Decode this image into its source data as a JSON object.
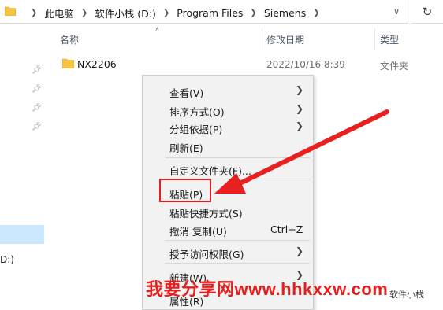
{
  "address_bar": {
    "crumbs": [
      "此电脑",
      "软件小栈 (D:)",
      "Program Files",
      "Siemens"
    ]
  },
  "columns": {
    "name": "名称",
    "modified": "修改日期",
    "type": "类型"
  },
  "files": [
    {
      "name": "NX2206",
      "modified": "2022/10/16 8:39",
      "type": "文件夹"
    }
  ],
  "left_pane": {
    "drive_label": "D:)"
  },
  "context_menu": {
    "view": "查看(V)",
    "sort": "排序方式(O)",
    "group": "分组依据(P)",
    "refresh": "刷新(E)",
    "customize": "自定义文件夹(F)...",
    "paste": "粘贴(P)",
    "paste_shortcut": "粘贴快捷方式(S)",
    "undo": "撤消 复制(U)",
    "undo_shortcut": "Ctrl+Z",
    "give_access": "授予访问权限(G)",
    "new": "新建(W)",
    "properties": "属性(R)"
  },
  "watermark": {
    "text": "我要分享网www.hhkxxw.com",
    "small": "软件小栈"
  },
  "colors": {
    "accent_red": "#e02020",
    "selection": "#cce8ff",
    "folder": "#f5c542"
  }
}
